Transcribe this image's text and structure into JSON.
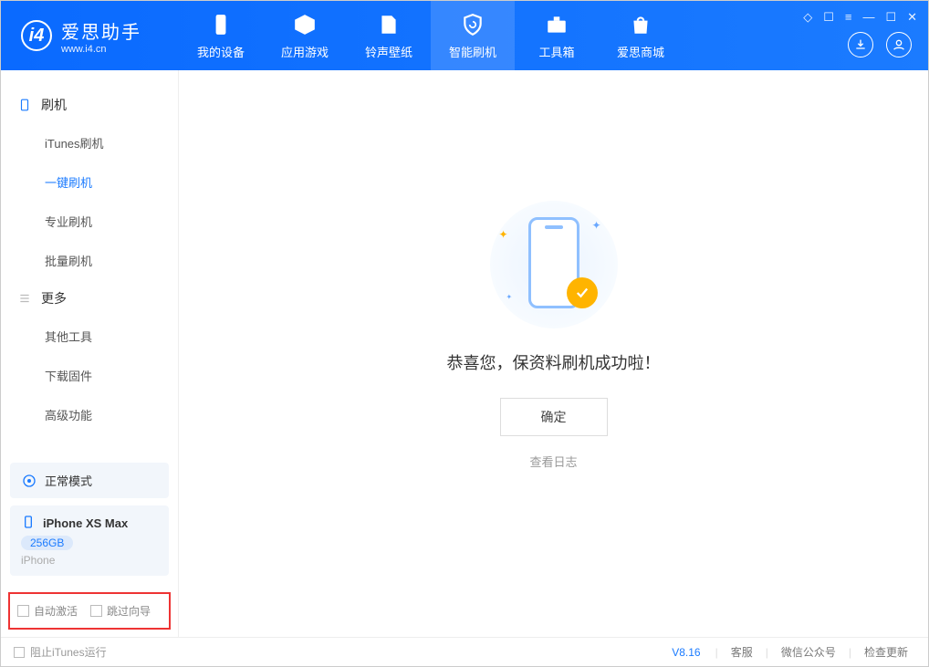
{
  "app": {
    "title": "爱思助手",
    "subtitle": "www.i4.cn"
  },
  "tabs": {
    "device": "我的设备",
    "apps": "应用游戏",
    "ring": "铃声壁纸",
    "flash": "智能刷机",
    "toolbox": "工具箱",
    "store": "爱思商城"
  },
  "sidebar": {
    "section_flash": "刷机",
    "items_flash": {
      "itunes": "iTunes刷机",
      "onekey": "一键刷机",
      "pro": "专业刷机",
      "batch": "批量刷机"
    },
    "section_more": "更多",
    "items_more": {
      "other": "其他工具",
      "firmware": "下载固件",
      "advanced": "高级功能"
    }
  },
  "device": {
    "mode": "正常模式",
    "name": "iPhone XS Max",
    "capacity": "256GB",
    "type": "iPhone"
  },
  "checks": {
    "auto_activate": "自动激活",
    "skip_guide": "跳过向导"
  },
  "main": {
    "success_text": "恭喜您，保资料刷机成功啦！",
    "ok": "确定",
    "view_log": "查看日志"
  },
  "status": {
    "block_itunes": "阻止iTunes运行",
    "version": "V8.16",
    "support": "客服",
    "wechat": "微信公众号",
    "update": "检查更新"
  }
}
